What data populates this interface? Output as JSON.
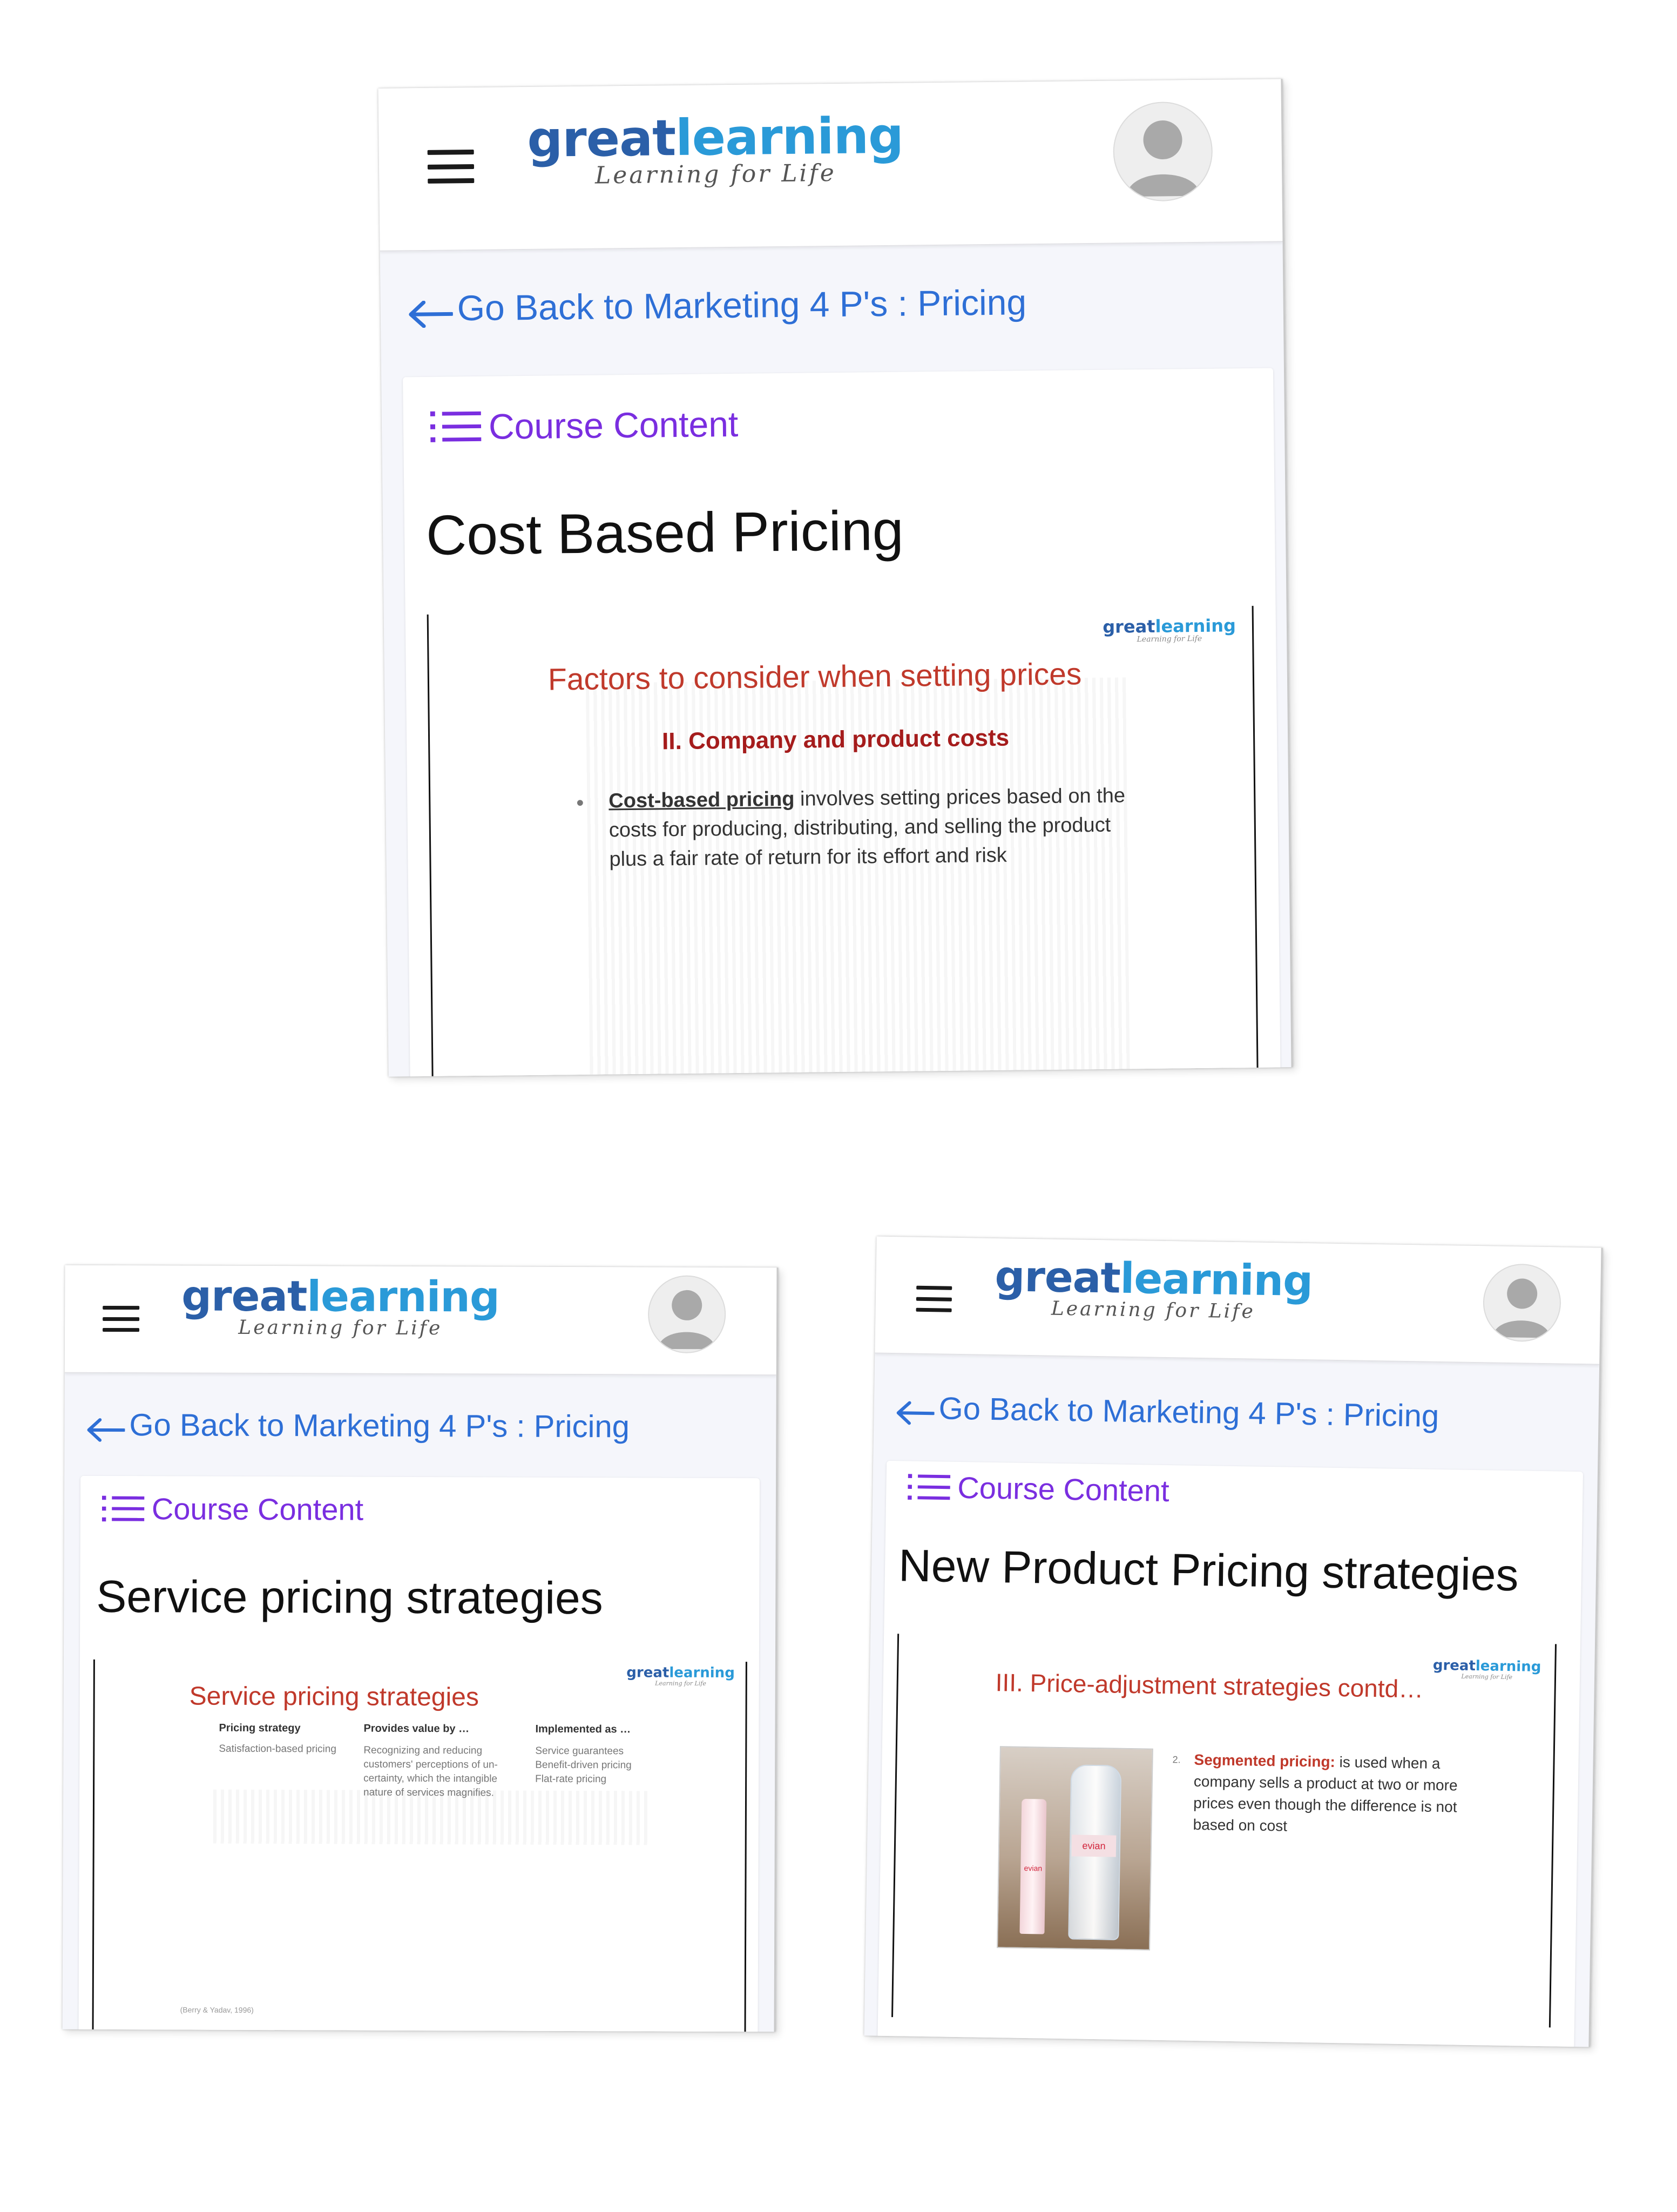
{
  "common": {
    "logo_main_1": "great",
    "logo_main_2": "learning",
    "logo_sub": "Learning for Life",
    "back_link": "Go Back to Marketing 4 P's : Pricing",
    "course_content": "Course Content"
  },
  "screen1": {
    "title": "Cost Based Pricing",
    "slide": {
      "heading": "Factors to consider when setting prices",
      "subheading": "II. Company and product costs",
      "bullet_term": "Cost-based pricing",
      "bullet_text": " involves setting prices based on the costs for producing, distributing, and selling the product plus a fair rate of return for its effort and risk"
    }
  },
  "screen2": {
    "title": "Service pricing strategies",
    "slide": {
      "heading": "Service pricing strategies",
      "columns": [
        "Pricing strategy",
        "Provides value by …",
        "Implemented as …"
      ],
      "row": [
        "Satisfaction-based pricing",
        "Recognizing and reducing customers' perceptions of un-certainty, which the intangible nature of services magnifies.",
        "Service guarantees\nBenefit-driven pricing\nFlat-rate pricing"
      ],
      "footnote": "(Berry & Yadav, 1996)"
    }
  },
  "screen3": {
    "title": "New Product Pricing strategies",
    "slide": {
      "heading": "III. Price-adjustment strategies contd…",
      "item_number": "2.",
      "item_term": "Segmented pricing:",
      "item_text": " is used when a company sells a product at two or more prices even though the difference is not based on cost",
      "photo_brand": "evian"
    }
  },
  "colors": {
    "link_blue": "#2e6fd6",
    "course_purple": "#7a2ee0",
    "slide_red": "#c0392b"
  }
}
